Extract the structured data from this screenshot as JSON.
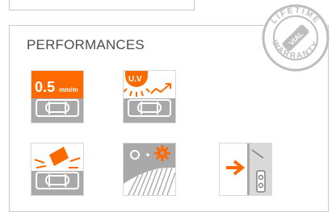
{
  "section": {
    "title": "PERFORMANCES"
  },
  "tiles": [
    {
      "icon": "precision-vial-icon",
      "value_text": "0.5",
      "unit_text": "mm/m"
    },
    {
      "icon": "uv-resistant-vial-icon",
      "label": "U.V"
    },
    {
      "icon": "shock-resistant-vial-icon"
    },
    {
      "icon": "gear-anti-slip-surface-icon"
    },
    {
      "icon": "vial-protection-icon"
    }
  ],
  "badge": {
    "icon": "lifetime-warranty-badge-icon",
    "top_text": "LIFETIME",
    "bottom_text": "WARRANTY",
    "center_text": "VIAL"
  },
  "colors": {
    "accent": "#ff6a00",
    "badge_gray": "#bdbdbd",
    "tile_gray": "#a9a9a9",
    "title_text": "#4d4d4d"
  }
}
